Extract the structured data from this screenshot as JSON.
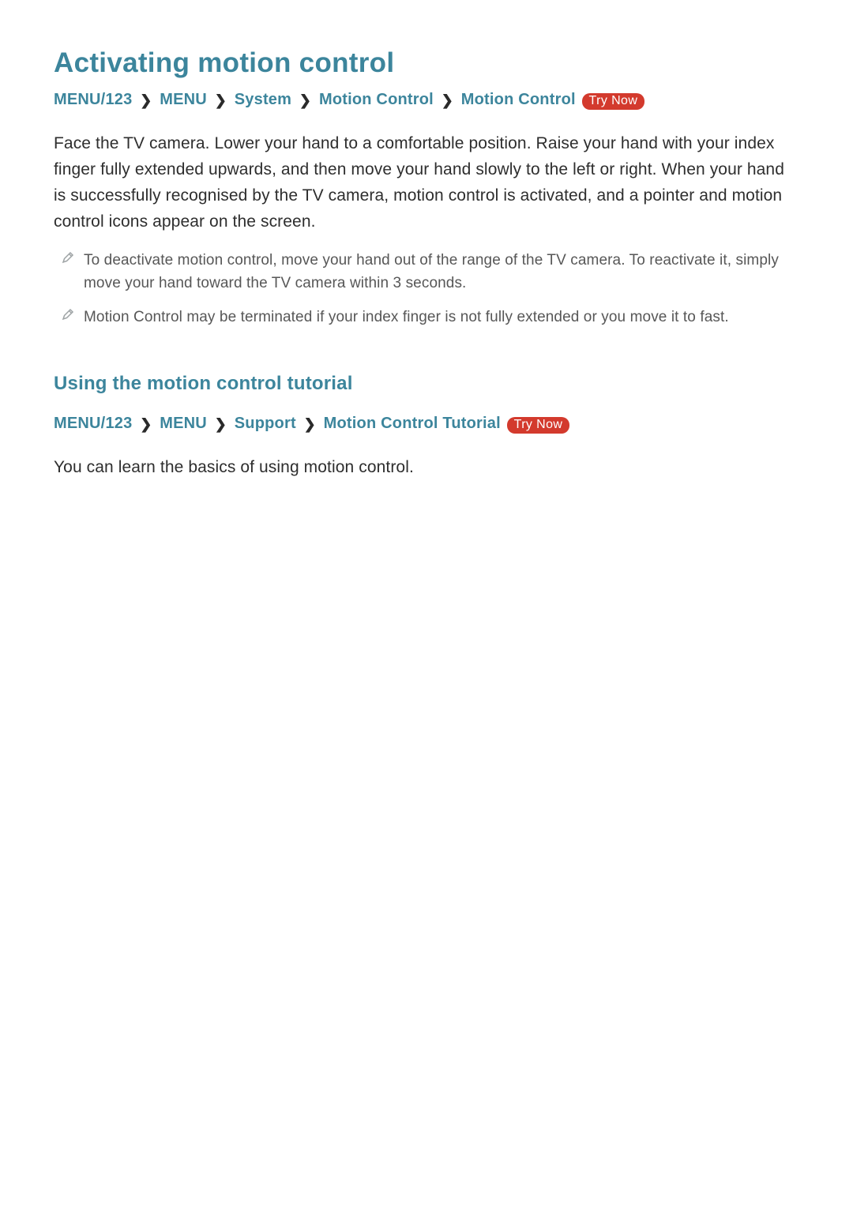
{
  "section1": {
    "title": "Activating motion control",
    "nav": {
      "items": [
        "MENU/123",
        "MENU",
        "System",
        "Motion Control",
        "Motion Control"
      ],
      "try_now": "Try Now"
    },
    "paragraph": "Face the TV camera. Lower your hand to a comfortable position. Raise your hand with your index finger fully extended upwards, and then move your hand slowly to the left or right. When your hand is successfully recognised by the TV camera, motion control is activated, and a pointer and motion control icons appear on the screen.",
    "notes": [
      "To deactivate motion control, move your hand out of the range of the TV camera. To reactivate it, simply move your hand toward the TV camera within 3 seconds.",
      "Motion Control may be terminated if your index finger is not fully extended or you move it to fast."
    ]
  },
  "section2": {
    "title": "Using the motion control tutorial",
    "nav": {
      "items": [
        "MENU/123",
        "MENU",
        "Support",
        "Motion Control Tutorial"
      ],
      "try_now": "Try Now"
    },
    "paragraph": "You can learn the basics of using motion control."
  }
}
